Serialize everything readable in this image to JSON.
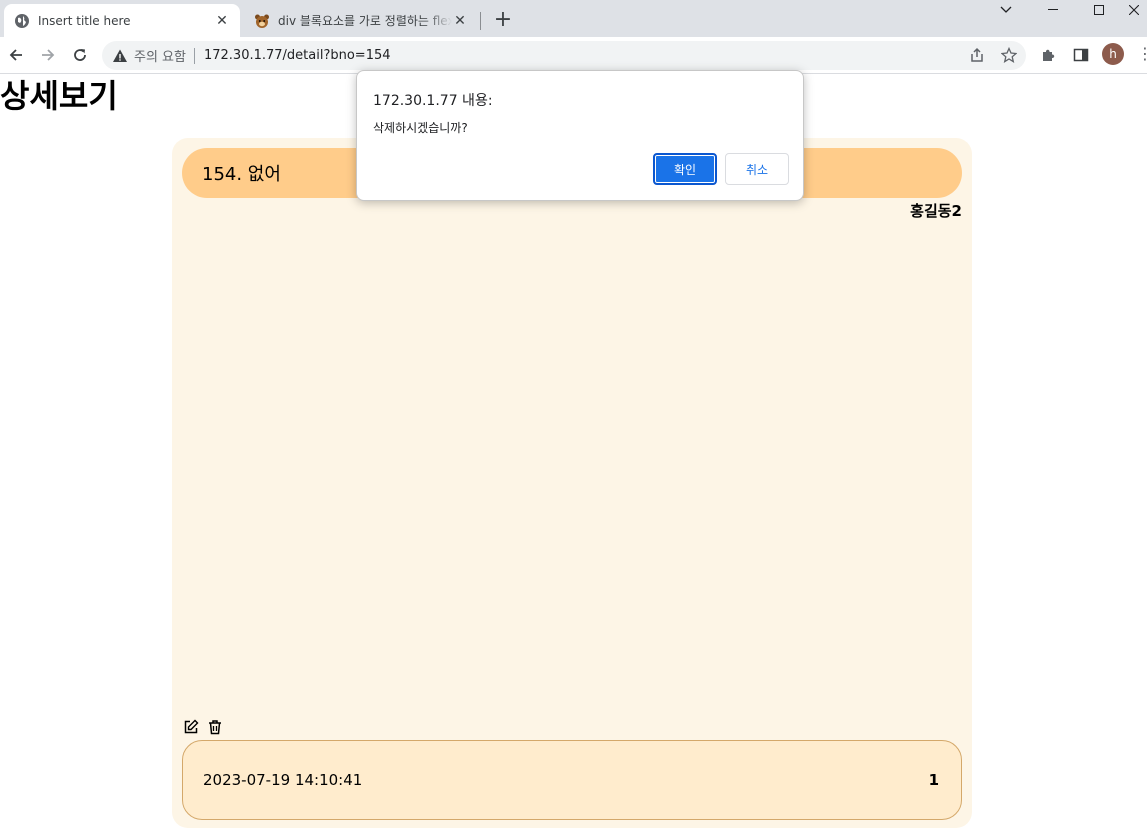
{
  "browser": {
    "tabs": [
      {
        "title": "Insert title here",
        "active": true
      },
      {
        "title": "div 블록요소를 가로 정렬하는 flex",
        "active": false
      }
    ],
    "omnibox": {
      "security_label": "주의 요함",
      "url": "172.30.1.77/detail?bno=154"
    },
    "profile_initial": "h",
    "icons": {
      "active_tab_favicon": "globe-icon",
      "inactive_tab_favicon": "bear-icon",
      "back": "arrow-left-icon",
      "forward": "arrow-right-icon",
      "reload": "reload-icon",
      "warning": "warning-triangle-icon",
      "share": "share-icon",
      "bookmark": "star-icon",
      "extensions": "puzzle-icon",
      "side_panel": "side-panel-icon"
    }
  },
  "page": {
    "title": "상세보기",
    "post": {
      "heading": "154. 없어",
      "writer": "홍길동2",
      "date": "2023-07-19 14:10:41",
      "count": "1"
    },
    "icons": {
      "edit": "edit-icon",
      "delete": "trash-icon"
    }
  },
  "dialog": {
    "origin": "172.30.1.77 내용:",
    "message": "삭제하시겠습니까?",
    "ok_label": "확인",
    "cancel_label": "취소"
  },
  "colors": {
    "card_background": "#fdf5e6",
    "title_bar": "#ffcc8a",
    "footer_bar": "#ffeccd",
    "dialog_ok": "#1a73e8"
  }
}
